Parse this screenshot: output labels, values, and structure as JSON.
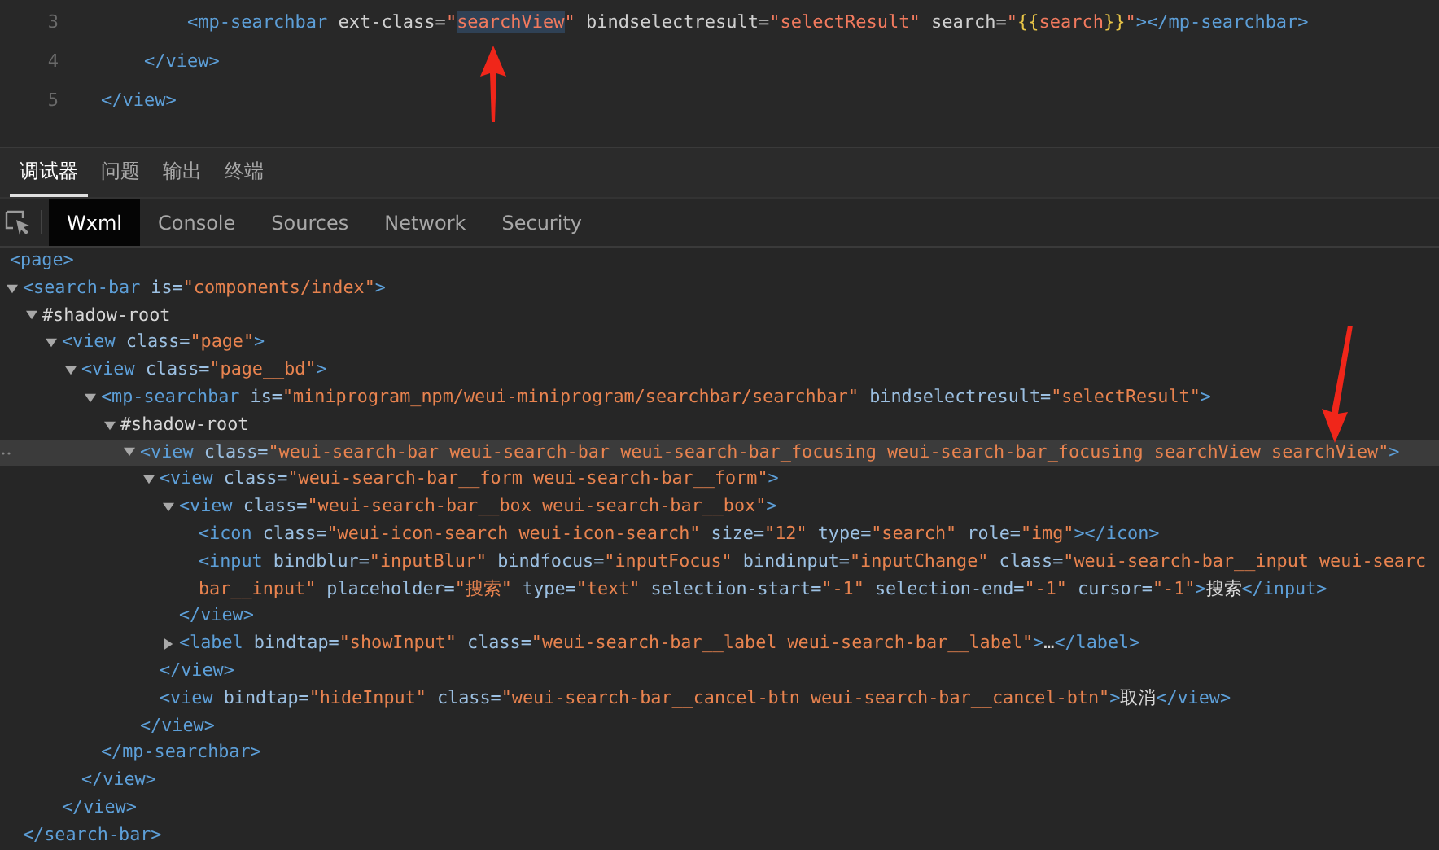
{
  "editor": {
    "lines": [
      {
        "number": "3",
        "tokens": [
          {
            "kind": "tag",
            "text": "        <mp-searchbar"
          },
          {
            "kind": "attr",
            "text": " ext-class="
          },
          {
            "kind": "value",
            "text": "\""
          },
          {
            "kind": "match",
            "text": "searchView"
          },
          {
            "kind": "value",
            "text": "\""
          },
          {
            "kind": "attr",
            "text": " bindselectresult="
          },
          {
            "kind": "value",
            "text": "\"selectResult\""
          },
          {
            "kind": "attr",
            "text": " search="
          },
          {
            "kind": "value",
            "text": "\""
          },
          {
            "kind": "brace",
            "text": "{{"
          },
          {
            "kind": "value",
            "text": "search"
          },
          {
            "kind": "brace",
            "text": "}}"
          },
          {
            "kind": "value",
            "text": "\""
          },
          {
            "kind": "tag",
            "text": "></mp-searchbar>"
          }
        ]
      },
      {
        "number": "4",
        "tokens": [
          {
            "kind": "tag",
            "text": "    </view>"
          }
        ]
      },
      {
        "number": "5",
        "tokens": [
          {
            "kind": "tag",
            "text": "</view>"
          }
        ]
      }
    ]
  },
  "panel_tabs": [
    {
      "label": "调试器",
      "selected": true
    },
    {
      "label": "问题",
      "selected": false
    },
    {
      "label": "输出",
      "selected": false
    },
    {
      "label": "终端",
      "selected": false
    }
  ],
  "sub_tabs": [
    {
      "label": "Wxml",
      "selected": true
    },
    {
      "label": "Console",
      "selected": false
    },
    {
      "label": "Sources",
      "selected": false
    },
    {
      "label": "Network",
      "selected": false
    },
    {
      "label": "Security",
      "selected": false
    }
  ],
  "tree": {
    "root": {
      "selected": false,
      "open": [
        {
          "kind": "tag",
          "text": "<page>"
        }
      ],
      "children": [
        {
          "kind": "branch",
          "expanded": true,
          "selected": false,
          "open": [
            {
              "kind": "tag",
              "text": "<search-bar"
            },
            {
              "kind": "attr",
              "text": " is="
            },
            {
              "kind": "value",
              "text": "\"components/index\""
            },
            {
              "kind": "tag",
              "text": ">"
            }
          ],
          "close": [
            {
              "kind": "tag",
              "text": "</search-bar>"
            }
          ],
          "children": [
            {
              "kind": "branch",
              "expanded": true,
              "selected": false,
              "open": [
                {
                  "kind": "text",
                  "text": "#shadow-root"
                }
              ],
              "children": [
                {
                  "kind": "branch",
                  "expanded": true,
                  "selected": false,
                  "open": [
                    {
                      "kind": "tag",
                      "text": "<view"
                    },
                    {
                      "kind": "attr",
                      "text": " class="
                    },
                    {
                      "kind": "value",
                      "text": "\"page\""
                    },
                    {
                      "kind": "tag",
                      "text": ">"
                    }
                  ],
                  "close": [
                    {
                      "kind": "tag",
                      "text": "</view>"
                    }
                  ],
                  "children": [
                    {
                      "kind": "branch",
                      "expanded": true,
                      "selected": false,
                      "open": [
                        {
                          "kind": "tag",
                          "text": "<view"
                        },
                        {
                          "kind": "attr",
                          "text": " class="
                        },
                        {
                          "kind": "value",
                          "text": "\"page__bd\""
                        },
                        {
                          "kind": "tag",
                          "text": ">"
                        }
                      ],
                      "close": [
                        {
                          "kind": "tag",
                          "text": "</view>"
                        }
                      ],
                      "children": [
                        {
                          "kind": "branch",
                          "expanded": true,
                          "selected": false,
                          "open": [
                            {
                              "kind": "tag",
                              "text": "<mp-searchbar"
                            },
                            {
                              "kind": "attr",
                              "text": " is="
                            },
                            {
                              "kind": "value",
                              "text": "\"miniprogram_npm/weui-miniprogram/searchbar/searchbar\""
                            },
                            {
                              "kind": "attr",
                              "text": " bindselectresult="
                            },
                            {
                              "kind": "value",
                              "text": "\"selectResult\""
                            },
                            {
                              "kind": "tag",
                              "text": ">"
                            }
                          ],
                          "close": [
                            {
                              "kind": "tag",
                              "text": "</mp-searchbar>"
                            }
                          ],
                          "children": [
                            {
                              "kind": "branch",
                              "expanded": true,
                              "selected": false,
                              "open": [
                                {
                                  "kind": "text",
                                  "text": "#shadow-root"
                                }
                              ],
                              "children": [
                                {
                                  "kind": "branch",
                                  "expanded": true,
                                  "selected": true,
                                  "open": [
                                    {
                                      "kind": "tag",
                                      "text": "<view"
                                    },
                                    {
                                      "kind": "attr",
                                      "text": " class="
                                    },
                                    {
                                      "kind": "value",
                                      "text": "\"weui-search-bar weui-search-bar weui-search-bar_focusing weui-search-bar_focusing searchView searchView\""
                                    },
                                    {
                                      "kind": "tag",
                                      "text": ">"
                                    }
                                  ],
                                  "close": [
                                    {
                                      "kind": "tag",
                                      "text": "</view>"
                                    }
                                  ],
                                  "children": [
                                    {
                                      "kind": "branch",
                                      "expanded": true,
                                      "selected": false,
                                      "open": [
                                        {
                                          "kind": "tag",
                                          "text": "<view"
                                        },
                                        {
                                          "kind": "attr",
                                          "text": " class="
                                        },
                                        {
                                          "kind": "value",
                                          "text": "\"weui-search-bar__form weui-search-bar__form\""
                                        },
                                        {
                                          "kind": "tag",
                                          "text": ">"
                                        }
                                      ],
                                      "close": [
                                        {
                                          "kind": "tag",
                                          "text": "</view>"
                                        }
                                      ],
                                      "children": [
                                        {
                                          "kind": "branch",
                                          "expanded": true,
                                          "selected": false,
                                          "open": [
                                            {
                                              "kind": "tag",
                                              "text": "<view"
                                            },
                                            {
                                              "kind": "attr",
                                              "text": " class="
                                            },
                                            {
                                              "kind": "value",
                                              "text": "\"weui-search-bar__box weui-search-bar__box\""
                                            },
                                            {
                                              "kind": "tag",
                                              "text": ">"
                                            }
                                          ],
                                          "close": [
                                            {
                                              "kind": "tag",
                                              "text": "</view>"
                                            }
                                          ],
                                          "children": [
                                            {
                                              "kind": "leaf",
                                              "selected": false,
                                              "lines": [
                                                [
                                                  {
                                                    "kind": "tag",
                                                    "text": "<icon"
                                                  },
                                                  {
                                                    "kind": "attr",
                                                    "text": " class="
                                                  },
                                                  {
                                                    "kind": "value",
                                                    "text": "\"weui-icon-search weui-icon-search\""
                                                  },
                                                  {
                                                    "kind": "attr",
                                                    "text": " size="
                                                  },
                                                  {
                                                    "kind": "value",
                                                    "text": "\"12\""
                                                  },
                                                  {
                                                    "kind": "attr",
                                                    "text": " type="
                                                  },
                                                  {
                                                    "kind": "value",
                                                    "text": "\"search\""
                                                  },
                                                  {
                                                    "kind": "attr",
                                                    "text": " role="
                                                  },
                                                  {
                                                    "kind": "value",
                                                    "text": "\"img\""
                                                  },
                                                  {
                                                    "kind": "tag",
                                                    "text": "></icon>"
                                                  }
                                                ]
                                              ]
                                            },
                                            {
                                              "kind": "leaf",
                                              "selected": false,
                                              "lines": [
                                                [
                                                  {
                                                    "kind": "tag",
                                                    "text": "<input"
                                                  },
                                                  {
                                                    "kind": "attr",
                                                    "text": " bindblur="
                                                  },
                                                  {
                                                    "kind": "value",
                                                    "text": "\"inputBlur\""
                                                  },
                                                  {
                                                    "kind": "attr",
                                                    "text": " bindfocus="
                                                  },
                                                  {
                                                    "kind": "value",
                                                    "text": "\"inputFocus\""
                                                  },
                                                  {
                                                    "kind": "attr",
                                                    "text": " bindinput="
                                                  },
                                                  {
                                                    "kind": "value",
                                                    "text": "\"inputChange\""
                                                  },
                                                  {
                                                    "kind": "attr",
                                                    "text": " class="
                                                  },
                                                  {
                                                    "kind": "value",
                                                    "text": "\"weui-search-bar__input weui-searc"
                                                  }
                                                ],
                                                [
                                                  {
                                                    "kind": "value",
                                                    "text": "bar__input\""
                                                  },
                                                  {
                                                    "kind": "attr",
                                                    "text": " placeholder="
                                                  },
                                                  {
                                                    "kind": "value",
                                                    "text": "\"搜索\""
                                                  },
                                                  {
                                                    "kind": "attr",
                                                    "text": " type="
                                                  },
                                                  {
                                                    "kind": "value",
                                                    "text": "\"text\""
                                                  },
                                                  {
                                                    "kind": "attr",
                                                    "text": " selection-start="
                                                  },
                                                  {
                                                    "kind": "value",
                                                    "text": "\"-1\""
                                                  },
                                                  {
                                                    "kind": "attr",
                                                    "text": " selection-end="
                                                  },
                                                  {
                                                    "kind": "value",
                                                    "text": "\"-1\""
                                                  },
                                                  {
                                                    "kind": "attr",
                                                    "text": " cursor="
                                                  },
                                                  {
                                                    "kind": "value",
                                                    "text": "\"-1\""
                                                  },
                                                  {
                                                    "kind": "tag",
                                                    "text": ">"
                                                  },
                                                  {
                                                    "kind": "text",
                                                    "text": "搜索"
                                                  },
                                                  {
                                                    "kind": "tag",
                                                    "text": "</input>"
                                                  }
                                                ]
                                              ]
                                            }
                                          ]
                                        },
                                        {
                                          "kind": "branch",
                                          "expanded": false,
                                          "selected": false,
                                          "open": [
                                            {
                                              "kind": "tag",
                                              "text": "<label"
                                            },
                                            {
                                              "kind": "attr",
                                              "text": " bindtap="
                                            },
                                            {
                                              "kind": "value",
                                              "text": "\"showInput\""
                                            },
                                            {
                                              "kind": "attr",
                                              "text": " class="
                                            },
                                            {
                                              "kind": "value",
                                              "text": "\"weui-search-bar__label weui-search-bar__label\""
                                            },
                                            {
                                              "kind": "tag",
                                              "text": ">"
                                            },
                                            {
                                              "kind": "text",
                                              "text": "…"
                                            },
                                            {
                                              "kind": "tag",
                                              "text": "</label>"
                                            }
                                          ]
                                        }
                                      ]
                                    },
                                    {
                                      "kind": "leaf",
                                      "selected": false,
                                      "lines": [
                                        [
                                          {
                                            "kind": "tag",
                                            "text": "<view"
                                          },
                                          {
                                            "kind": "attr",
                                            "text": " bindtap="
                                          },
                                          {
                                            "kind": "value",
                                            "text": "\"hideInput\""
                                          },
                                          {
                                            "kind": "attr",
                                            "text": " class="
                                          },
                                          {
                                            "kind": "value",
                                            "text": "\"weui-search-bar__cancel-btn weui-search-bar__cancel-btn\""
                                          },
                                          {
                                            "kind": "tag",
                                            "text": ">"
                                          },
                                          {
                                            "kind": "text",
                                            "text": "取消"
                                          },
                                          {
                                            "kind": "tag",
                                            "text": "</view>"
                                          }
                                        ]
                                      ]
                                    }
                                  ]
                                }
                              ]
                            }
                          ]
                        }
                      ]
                    }
                  ]
                }
              ]
            }
          ]
        }
      ]
    }
  }
}
